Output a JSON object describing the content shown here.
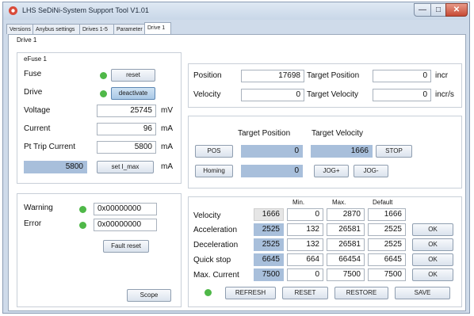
{
  "window": {
    "title": "LHS SeDiNi-System Support Tool V1.01"
  },
  "titlebar_buttons": {
    "minimize": "—",
    "maximize": "□",
    "close": "✕"
  },
  "tabs": [
    {
      "label": "Versions"
    },
    {
      "label": "Anybus settings"
    },
    {
      "label": "Drives 1-5"
    },
    {
      "label": "Parameter"
    },
    {
      "label": "Drive 1"
    }
  ],
  "drive": {
    "title": "Drive 1",
    "efuse": {
      "title": "eFuse 1",
      "fuse_label": "Fuse",
      "reset_button": "reset",
      "drive_label": "Drive",
      "deactivate_button": "deactivate",
      "voltage": {
        "label": "Voltage",
        "value": "25745",
        "unit": "mV"
      },
      "current": {
        "label": "Current",
        "value": "96",
        "unit": "mA"
      },
      "pt_trip": {
        "label": "Pt Trip Current",
        "value": "5800",
        "unit": "mA"
      },
      "imax": {
        "value": "5800",
        "button": "set I_max",
        "unit": "mA"
      }
    },
    "status": {
      "warning": {
        "label": "Warning",
        "value": "0x00000000"
      },
      "error": {
        "label": "Error",
        "value": "0x00000000"
      },
      "fault_reset_button": "Fault reset",
      "scope_button": "Scope"
    },
    "position_panel": {
      "position": {
        "label": "Position",
        "value": "17698"
      },
      "target_position": {
        "label": "Target Position",
        "value": "0",
        "unit": "incr"
      },
      "velocity": {
        "label": "Velocity",
        "value": "0"
      },
      "target_velocity": {
        "label": "Target Velocity",
        "value": "0",
        "unit": "incr/s"
      }
    },
    "motion": {
      "target_position_header": "Target Position",
      "target_velocity_header": "Target Velocity",
      "pos_button": "POS",
      "pos_value": "0",
      "velocity_value": "1666",
      "stop_button": "STOP",
      "homing_button": "Homing",
      "homing_value": "0",
      "jog_plus_button": "JOG+",
      "jog_minus_button": "JOG-"
    },
    "params": {
      "headers": {
        "min": "Min.",
        "max": "Max.",
        "default": "Default"
      },
      "rows": [
        {
          "label": "Velocity",
          "value": "1666",
          "min": "0",
          "max": "2870",
          "default": "1666"
        },
        {
          "label": "Acceleration",
          "value": "2525",
          "min": "132",
          "max": "26581",
          "default": "2525",
          "ok": "OK"
        },
        {
          "label": "Deceleration",
          "value": "2525",
          "min": "132",
          "max": "26581",
          "default": "2525",
          "ok": "OK"
        },
        {
          "label": "Quick stop",
          "value": "6645",
          "min": "664",
          "max": "66454",
          "default": "6645",
          "ok": "OK"
        },
        {
          "label": "Max. Current",
          "value": "7500",
          "min": "0",
          "max": "7500",
          "default": "7500",
          "ok": "OK"
        }
      ],
      "refresh_button": "REFRESH",
      "reset_button": "RESET",
      "restore_button": "RESTORE",
      "save_button": "SAVE"
    }
  },
  "colors": {
    "led_green": "#4fb848",
    "field_blue": "#a8bfdb",
    "window_frame": "#cfdbea"
  }
}
